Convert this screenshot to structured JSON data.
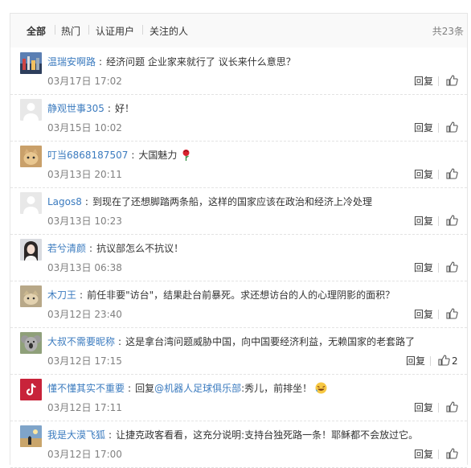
{
  "tabs": [
    {
      "label": "全部",
      "active": true
    },
    {
      "label": "热门",
      "active": false
    },
    {
      "label": "认证用户",
      "active": false
    },
    {
      "label": "关注的人",
      "active": false
    }
  ],
  "total": "共23条",
  "reply_label": "回复",
  "comments": [
    {
      "user": "温瑞安啊路",
      "text": "经济问题 企业家来就行了 议长来什么意思？",
      "time": "03月17日 17:02",
      "avatar": "city-avatar"
    },
    {
      "user": "静观世事305",
      "text": "好！",
      "time": "03月15日 10:02",
      "avatar": "default-avatar"
    },
    {
      "user": "叮当6868187507",
      "text": "大国魅力",
      "emoji": "rose-emoji",
      "time": "03月13日 20:11",
      "avatar": "cat-avatar"
    },
    {
      "user": "Lagos8",
      "text": "到现在了还想脚踏两条船，这样的国家应该在政治和经济上冷处理",
      "time": "03月13日 10:23",
      "avatar": "default-avatar"
    },
    {
      "user": "若兮清颜",
      "text": "抗议部怎么不抗议！",
      "time": "03月13日 06:38",
      "avatar": "girl-avatar"
    },
    {
      "user": "木刀王",
      "text": "前任非要\"访台\"，结果赴台前暴死。求还想访台的人的心理阴影的面积？",
      "time": "03月12日 23:40",
      "avatar": "cat-avatar-2"
    },
    {
      "user": "大叔不需要昵称",
      "text": "这是拿台湾问题威胁中国，向中国要经济利益，无赖国家的老套路了",
      "time": "03月12日 17:15",
      "avatar": "koala-avatar",
      "likes": "2"
    },
    {
      "user": "懂不懂其实不重要",
      "text_pre": "回复",
      "mention": "@机器人足球俱乐部",
      "text_post": ":秀儿，前排坐！",
      "emoji": "laugh-emoji",
      "time": "03月12日 17:11",
      "avatar": "tiktok-avatar"
    },
    {
      "user": "我是大漠飞狐",
      "text": "让捷克政客看看，这充分说明:支持台独死路一条！耶稣都不会放过它。",
      "time": "03月12日 17:00",
      "avatar": "desert-avatar"
    }
  ]
}
